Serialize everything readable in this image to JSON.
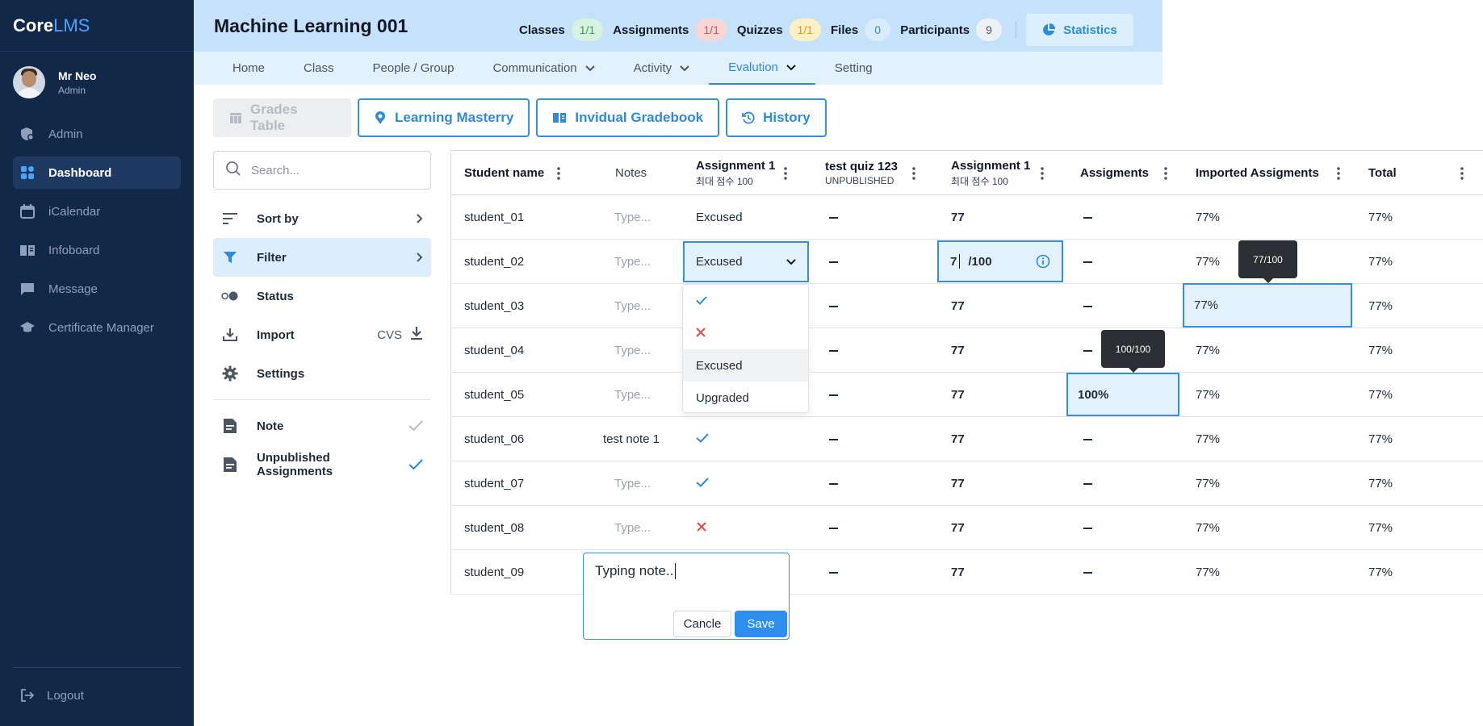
{
  "brand": {
    "core": "Core",
    "lms": "LMS"
  },
  "user": {
    "name": "Mr Neo",
    "role": "Admin"
  },
  "sidebar": {
    "items": [
      {
        "label": "Admin",
        "icon": "admin-shield-icon"
      },
      {
        "label": "Dashboard",
        "icon": "dashboard-grid-icon"
      },
      {
        "label": "iCalendar",
        "icon": "calendar-icon"
      },
      {
        "label": "Infoboard",
        "icon": "book-icon"
      },
      {
        "label": "Message",
        "icon": "message-icon"
      },
      {
        "label": "Certificate Manager",
        "icon": "graduation-cap-icon"
      }
    ],
    "logout": "Logout"
  },
  "header": {
    "title": "Machine Learning 001",
    "counters": [
      {
        "label": "Classes",
        "value": "1/1",
        "color": "green"
      },
      {
        "label": "Assignments",
        "value": "1/1",
        "color": "red"
      },
      {
        "label": "Quizzes",
        "value": "1/1",
        "color": "yellow"
      },
      {
        "label": "Files",
        "value": "0",
        "color": "blue"
      },
      {
        "label": "Participants",
        "value": "9",
        "color": "gray"
      }
    ],
    "statistics": "Statistics"
  },
  "subnav": {
    "items": [
      {
        "label": "Home"
      },
      {
        "label": "Class"
      },
      {
        "label": "People / Group"
      },
      {
        "label": "Communication"
      },
      {
        "label": "Activity"
      },
      {
        "label": "Evalution"
      },
      {
        "label": "Setting"
      }
    ]
  },
  "tools": {
    "grades_table": "Grades Table",
    "learning_mastery": "Learning Masterry",
    "individual_gradebook": "Invidual Gradebook",
    "history": "History"
  },
  "search": {
    "placeholder": "Search..."
  },
  "panel": {
    "sort_by": "Sort by",
    "filter": "Filter",
    "status": "Status",
    "import": "Import",
    "import_format": "CVS",
    "settings": "Settings",
    "note": "Note",
    "unpublished": "Unpublished Assignments"
  },
  "table": {
    "headers": {
      "student": "Student name",
      "notes": "Notes",
      "a1": "Assignment 1",
      "a1_sub": "최대 점수 100",
      "quiz": "test quiz 123",
      "quiz_sub": "UNPUBLISHED",
      "a1b": "Assignment 1",
      "a1b_sub": "최대 점수 100",
      "assig": "Assigments",
      "imported": "Imported Assigments",
      "total": "Total"
    },
    "rows": [
      {
        "name": "student_01",
        "note": "Type...",
        "a1": "Excused",
        "a1b": "77",
        "imported": "77%",
        "total": "77%"
      },
      {
        "name": "student_02",
        "note": "Type...",
        "a1": "Excused",
        "a1b": "7",
        "imported": "77%",
        "total": "77%"
      },
      {
        "name": "student_03",
        "note": "Type...",
        "a1": "",
        "a1b": "77",
        "imported": "77%",
        "total": "77%"
      },
      {
        "name": "student_04",
        "note": "Type...",
        "a1": "",
        "a1b": "77",
        "imported": "77%",
        "total": "77%"
      },
      {
        "name": "student_05",
        "note": "Type...",
        "a1": "",
        "a1b": "77",
        "assig": "100%",
        "imported": "77%",
        "total": "77%"
      },
      {
        "name": "student_06",
        "note": "test note 1",
        "a1": "check",
        "a1b": "77",
        "imported": "77%",
        "total": "77%"
      },
      {
        "name": "student_07",
        "note": "Type...",
        "a1": "check",
        "a1b": "77",
        "imported": "77%",
        "total": "77%"
      },
      {
        "name": "student_08",
        "note": "Type...",
        "a1": "cross",
        "a1b": "77",
        "imported": "77%",
        "total": "77%"
      },
      {
        "name": "student_09",
        "note": "",
        "a1": "",
        "a1b": "77",
        "imported": "77%",
        "total": "77%"
      }
    ],
    "score_suffix": "/100",
    "tooltip_imported": "77/100",
    "tooltip_assig": "100/100"
  },
  "dropdown": {
    "selected": "Excused",
    "options": [
      {
        "label": "",
        "icon": "check-icon"
      },
      {
        "label": "",
        "icon": "cross-icon"
      },
      {
        "label": "Excused"
      },
      {
        "label": "Upgraded"
      }
    ]
  },
  "note_popup": {
    "text": "Typing note..",
    "cancel": "Cancle",
    "save": "Save"
  },
  "colors": {
    "accent": "#2f8bd8",
    "sidebar": "#112849",
    "header": "#c6e2fb",
    "success": "#27a157",
    "danger": "#e04b4b"
  }
}
